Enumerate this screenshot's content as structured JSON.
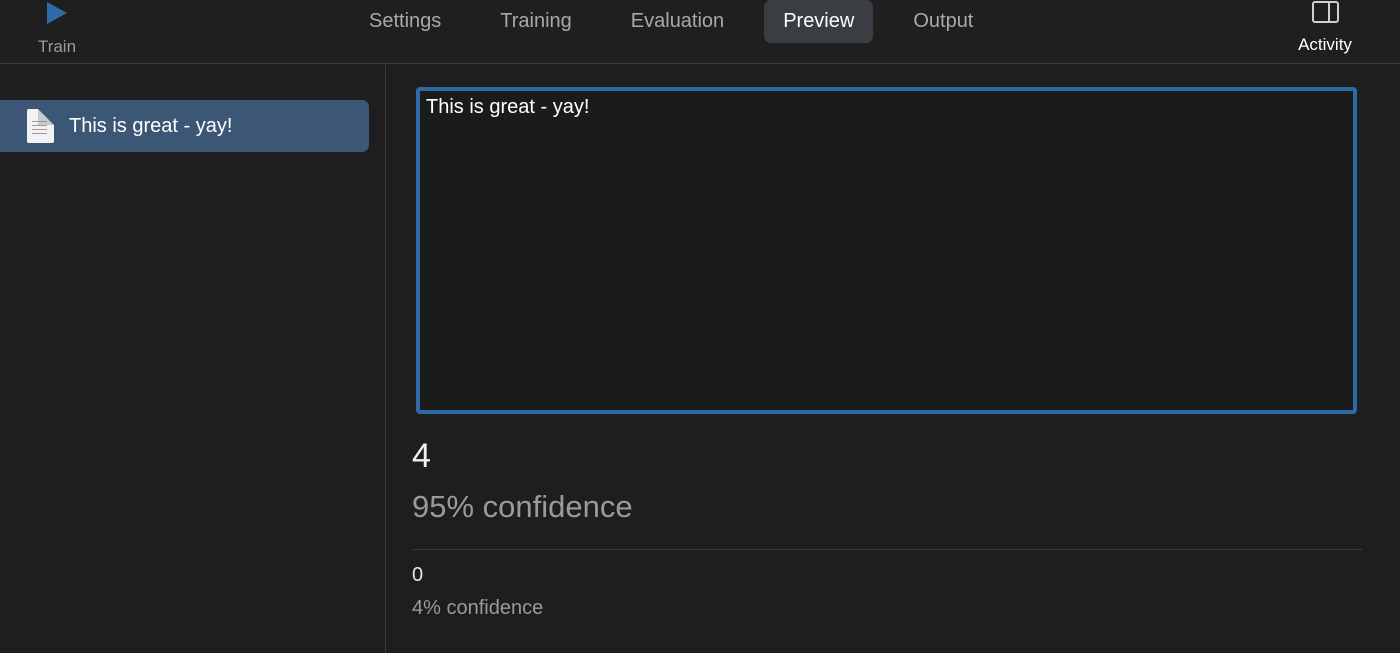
{
  "toolbar": {
    "train_label": "Train",
    "activity_label": "Activity",
    "tabs": [
      {
        "label": "Settings",
        "active": false
      },
      {
        "label": "Training",
        "active": false
      },
      {
        "label": "Evaluation",
        "active": false
      },
      {
        "label": "Preview",
        "active": true
      },
      {
        "label": "Output",
        "active": false
      }
    ]
  },
  "sidebar": {
    "items": [
      {
        "label": "This is great - yay!",
        "icon": "document-icon",
        "selected": true
      }
    ]
  },
  "preview": {
    "input_text": "This is great - yay!",
    "results": [
      {
        "label": "4",
        "confidence": "95% confidence"
      },
      {
        "label": "0",
        "confidence": "4% confidence"
      }
    ]
  },
  "colors": {
    "accent": "#2f6aa8",
    "selection": "#3c5676",
    "background": "#1e1e1e"
  }
}
